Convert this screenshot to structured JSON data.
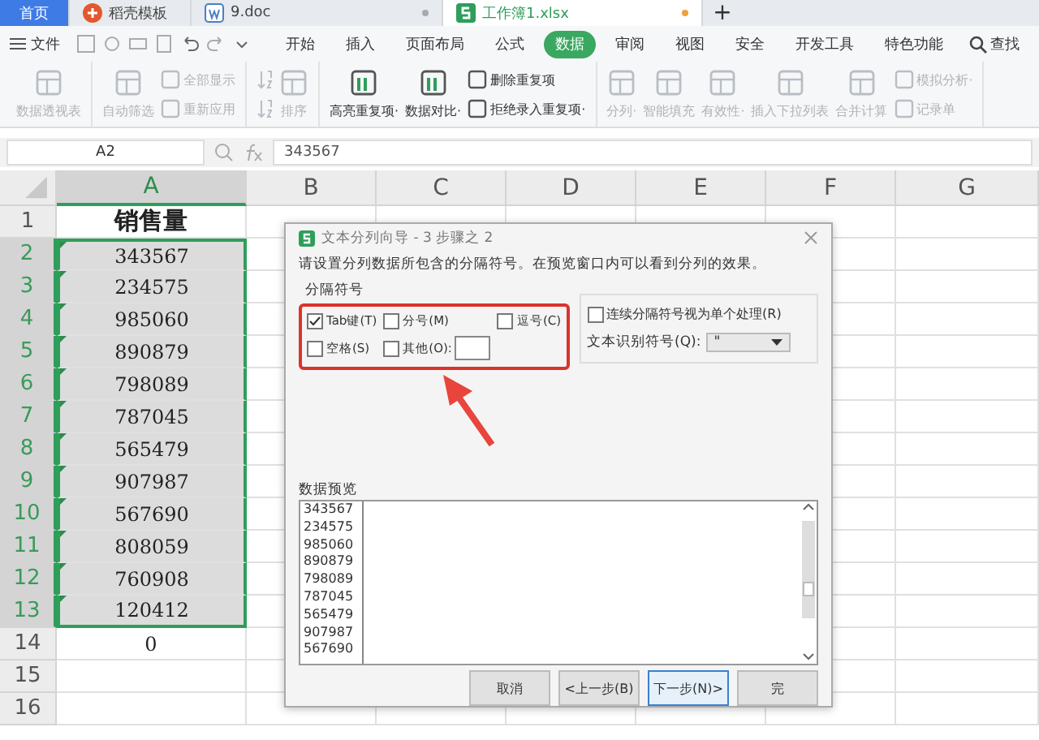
{
  "doc_tabs": [
    {
      "label": "首页",
      "kind": "home",
      "selected": false
    },
    {
      "label": "稻壳模板",
      "kind": "docer",
      "selected": false
    },
    {
      "label": "9.doc",
      "kind": "doc",
      "selected": false
    },
    {
      "label": "工作簿1.xlsx",
      "kind": "sheet",
      "selected": true
    }
  ],
  "new_tab": "+",
  "file_menu": "文件",
  "menu_tabs": [
    {
      "label": "开始",
      "selected": false
    },
    {
      "label": "插入",
      "selected": false
    },
    {
      "label": "页面布局",
      "selected": false
    },
    {
      "label": "公式",
      "selected": false
    },
    {
      "label": "数据",
      "selected": true
    },
    {
      "label": "审阅",
      "selected": false
    },
    {
      "label": "视图",
      "selected": false
    },
    {
      "label": "安全",
      "selected": false
    },
    {
      "label": "开发工具",
      "selected": false
    },
    {
      "label": "特色功能",
      "selected": false
    }
  ],
  "search": "查找",
  "ribbon": [
    {
      "items": [
        {
          "kind": "big",
          "label": "数据透视表"
        }
      ]
    },
    {
      "items": [
        {
          "kind": "big",
          "label": "自动筛选"
        },
        {
          "kind": "small",
          "label": "全部显示"
        },
        {
          "kind": "small",
          "label": "重新应用"
        }
      ]
    },
    {
      "items": [
        {
          "kind": "icon"
        },
        {
          "kind": "big",
          "label": "排序"
        }
      ]
    },
    {
      "items": [
        {
          "kind": "big",
          "label": "高亮重复项·"
        },
        {
          "kind": "big",
          "label": "数据对比·"
        },
        {
          "kind": "small",
          "label": "删除重复项"
        },
        {
          "kind": "small",
          "label": "拒绝录入重复项·"
        }
      ]
    },
    {
      "items": [
        {
          "kind": "big",
          "label": "分列·"
        },
        {
          "kind": "big",
          "label": "智能填充"
        },
        {
          "kind": "big",
          "label": "有效性·"
        },
        {
          "kind": "big",
          "label": "插入下拉列表"
        },
        {
          "kind": "big",
          "label": "合并计算"
        },
        {
          "kind": "small",
          "label": "模拟分析·"
        },
        {
          "kind": "small",
          "label": "记录单"
        }
      ]
    }
  ],
  "name_box": "A2",
  "formula": "343567",
  "sheet": {
    "columns": [
      {
        "label": "A",
        "selected": true
      },
      {
        "label": "B",
        "selected": false
      },
      {
        "label": "C",
        "selected": false
      },
      {
        "label": "D",
        "selected": false
      },
      {
        "label": "E",
        "selected": false
      },
      {
        "label": "F",
        "selected": false
      },
      {
        "label": "G",
        "selected": false
      }
    ],
    "rows": [
      {
        "label": "1",
        "selected": false,
        "value": "销售量",
        "kind": "header"
      },
      {
        "label": "2",
        "selected": true,
        "value": "343567"
      },
      {
        "label": "3",
        "selected": true,
        "value": "234575"
      },
      {
        "label": "4",
        "selected": true,
        "value": "985060"
      },
      {
        "label": "5",
        "selected": true,
        "value": "890879"
      },
      {
        "label": "6",
        "selected": true,
        "value": "798089"
      },
      {
        "label": "7",
        "selected": true,
        "value": "787045"
      },
      {
        "label": "8",
        "selected": true,
        "value": "565479"
      },
      {
        "label": "9",
        "selected": true,
        "value": "907987"
      },
      {
        "label": "10",
        "selected": true,
        "value": "567690"
      },
      {
        "label": "11",
        "selected": true,
        "value": "808059"
      },
      {
        "label": "12",
        "selected": true,
        "value": "760908"
      },
      {
        "label": "13",
        "selected": true,
        "value": "120412"
      },
      {
        "label": "14",
        "selected": false,
        "value": "0"
      },
      {
        "label": "15",
        "selected": false
      },
      {
        "label": "16",
        "selected": false
      }
    ]
  },
  "dialog": {
    "title": "文本分列向导 - 3 步骤之 2",
    "instruction": "请设置分列数据所包含的分隔符号。在预览窗口内可以看到分列的效果。",
    "group_label": "分隔符号",
    "delimiters": [
      {
        "label": "Tab键(T)",
        "checked": true
      },
      {
        "label": "分号(M)",
        "checked": false
      },
      {
        "label": "逗号(C)",
        "checked": false
      },
      {
        "label": "空格(S)",
        "checked": false
      },
      {
        "label": "其他(O):",
        "checked": false,
        "kind": "other"
      }
    ],
    "consecutive": {
      "label": "连续分隔符号视为单个处理(R)",
      "checked": false
    },
    "qualifier": {
      "label": "文本识别符号(Q):",
      "value": "\""
    },
    "preview_label": "数据预览",
    "preview_rows": [
      "343567",
      "234575",
      "985060",
      "890879",
      "798089",
      "787045",
      "565479",
      "907987",
      "567690"
    ],
    "buttons": [
      "取消",
      "<上一步(B)",
      "下一步(N)>",
      "完"
    ]
  }
}
